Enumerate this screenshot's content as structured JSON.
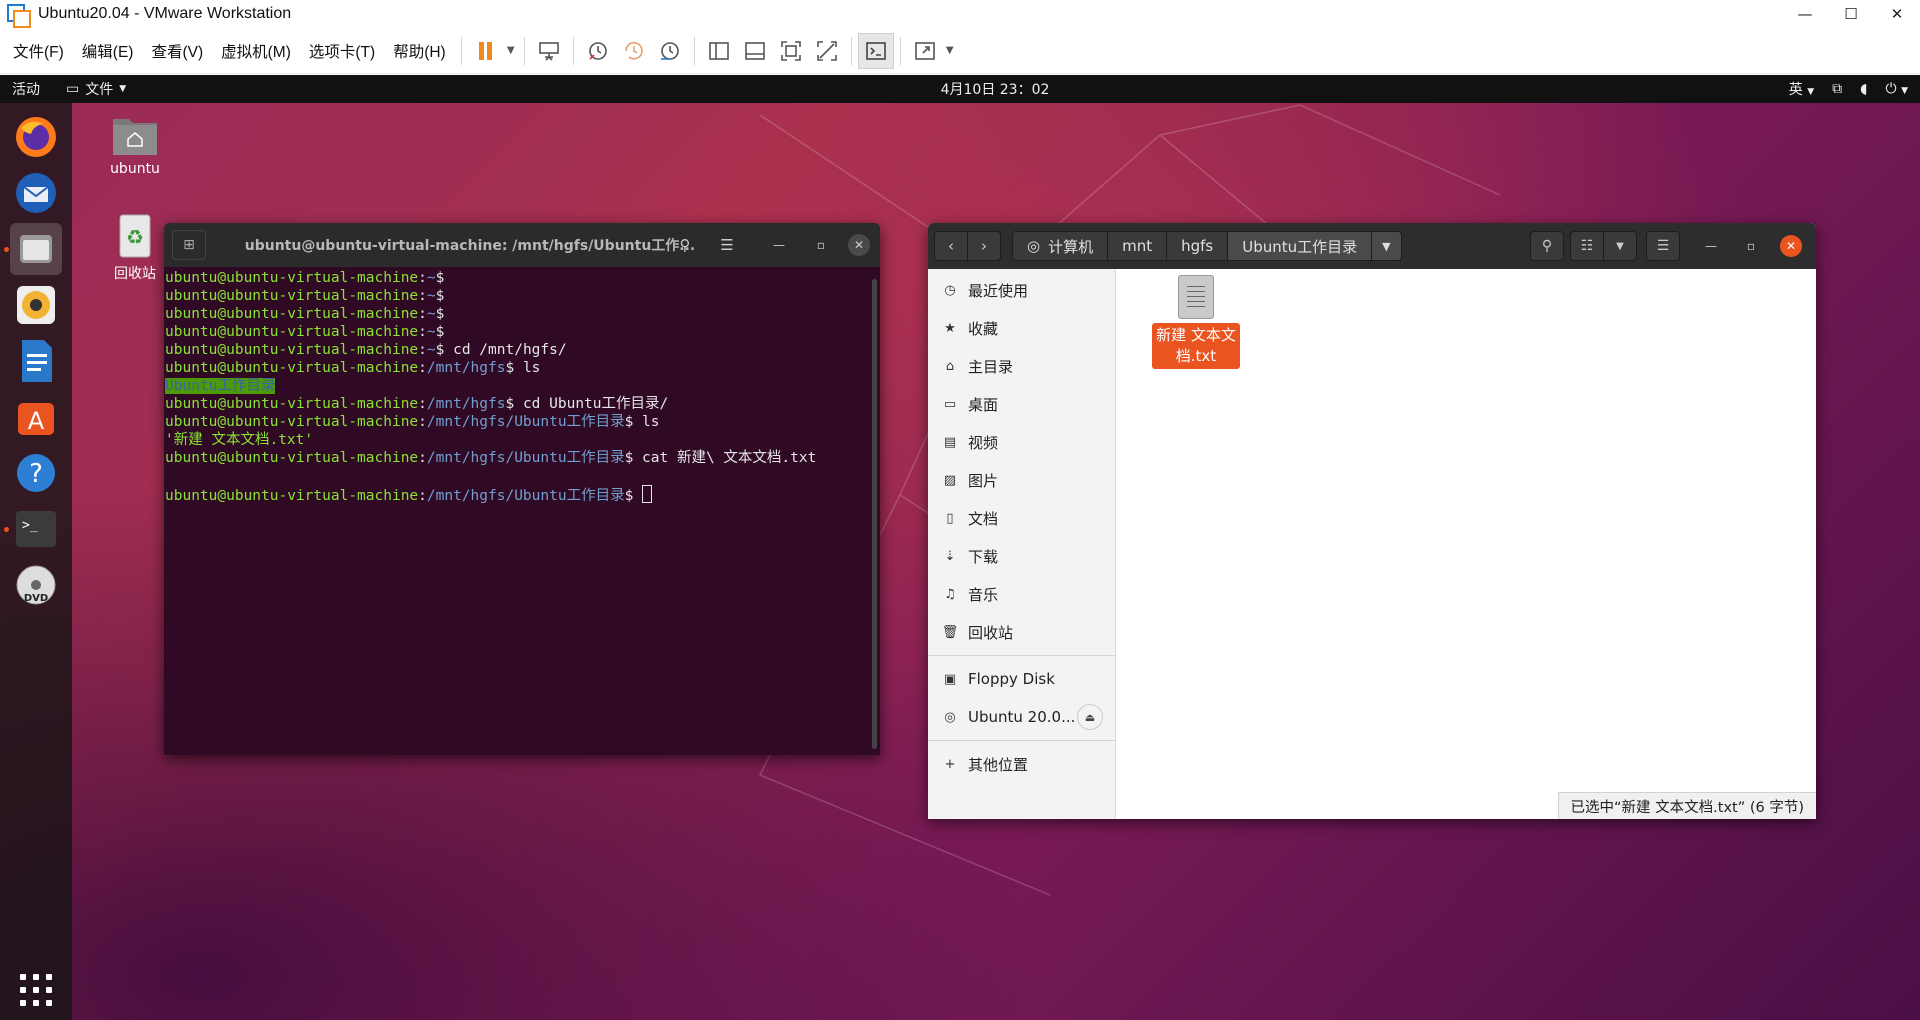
{
  "window": {
    "title": "Ubuntu20.04 - VMware Workstation",
    "minimize": "—",
    "maximize": "☐",
    "close": "✕"
  },
  "menubar": {
    "items": [
      "文件(F)",
      "编辑(E)",
      "查看(V)",
      "虚拟机(M)",
      "选项卡(T)",
      "帮助(H)"
    ]
  },
  "guest_topbar": {
    "activities": "活动",
    "files_menu": "文件",
    "clock": "4月10日  23：02",
    "input_method": "英"
  },
  "desktop_icons": {
    "home": "ubuntu",
    "trash": "回收站"
  },
  "terminal": {
    "title": "ubuntu@ubuntu-virtual-machine: /mnt/hgfs/Ubuntu工作...",
    "user": "ubuntu@ubuntu-virtual-machine",
    "lines": [
      {
        "path": "~",
        "cmd": ""
      },
      {
        "path": "~",
        "cmd": ""
      },
      {
        "path": "~",
        "cmd": ""
      },
      {
        "path": "~",
        "cmd": ""
      },
      {
        "path": "~",
        "cmd": " cd /mnt/hgfs/"
      },
      {
        "path": "/mnt/hgfs",
        "cmd": " ls"
      },
      {
        "output_dir": "Ubuntu工作目录"
      },
      {
        "path": "/mnt/hgfs",
        "cmd": " cd Ubuntu工作目录/"
      },
      {
        "path": "/mnt/hgfs/Ubuntu工作目录",
        "cmd": " ls"
      },
      {
        "output_file": "'新建 文本文档.txt'"
      },
      {
        "path": "/mnt/hgfs/Ubuntu工作目录",
        "cmd": " cat 新建\\ 文本文档.txt"
      },
      {
        "blank": ""
      },
      {
        "path": "/mnt/hgfs/Ubuntu工作目录",
        "cmd": " ",
        "cursor": true
      }
    ]
  },
  "files_window": {
    "breadcrumbs": [
      "计算机",
      "mnt",
      "hgfs",
      "Ubuntu工作目录"
    ],
    "sidebar": [
      {
        "icon": "clock-icon",
        "label": "最近使用"
      },
      {
        "icon": "star-icon",
        "label": "收藏"
      },
      {
        "icon": "home-icon",
        "label": "主目录"
      },
      {
        "icon": "desktop-icon",
        "label": "桌面"
      },
      {
        "icon": "video-icon",
        "label": "视频"
      },
      {
        "icon": "picture-icon",
        "label": "图片"
      },
      {
        "icon": "document-icon",
        "label": "文档"
      },
      {
        "icon": "download-icon",
        "label": "下载"
      },
      {
        "icon": "music-icon",
        "label": "音乐"
      },
      {
        "icon": "trash-icon",
        "label": "回收站"
      }
    ],
    "devices": [
      {
        "icon": "floppy-icon",
        "label": "Floppy Disk"
      },
      {
        "icon": "disc-icon",
        "label": "Ubuntu 20.0..."
      }
    ],
    "other_locations": "其他位置",
    "file": {
      "name_line1": "新建 文本文",
      "name_line2": "档.txt"
    },
    "status": "已选中“新建 文本文档.txt” (6 字节)"
  },
  "colors": {
    "accent": "#e95420",
    "terminal_bg": "#300a24",
    "prompt_user": "#8ae234",
    "prompt_path": "#729fcf"
  }
}
